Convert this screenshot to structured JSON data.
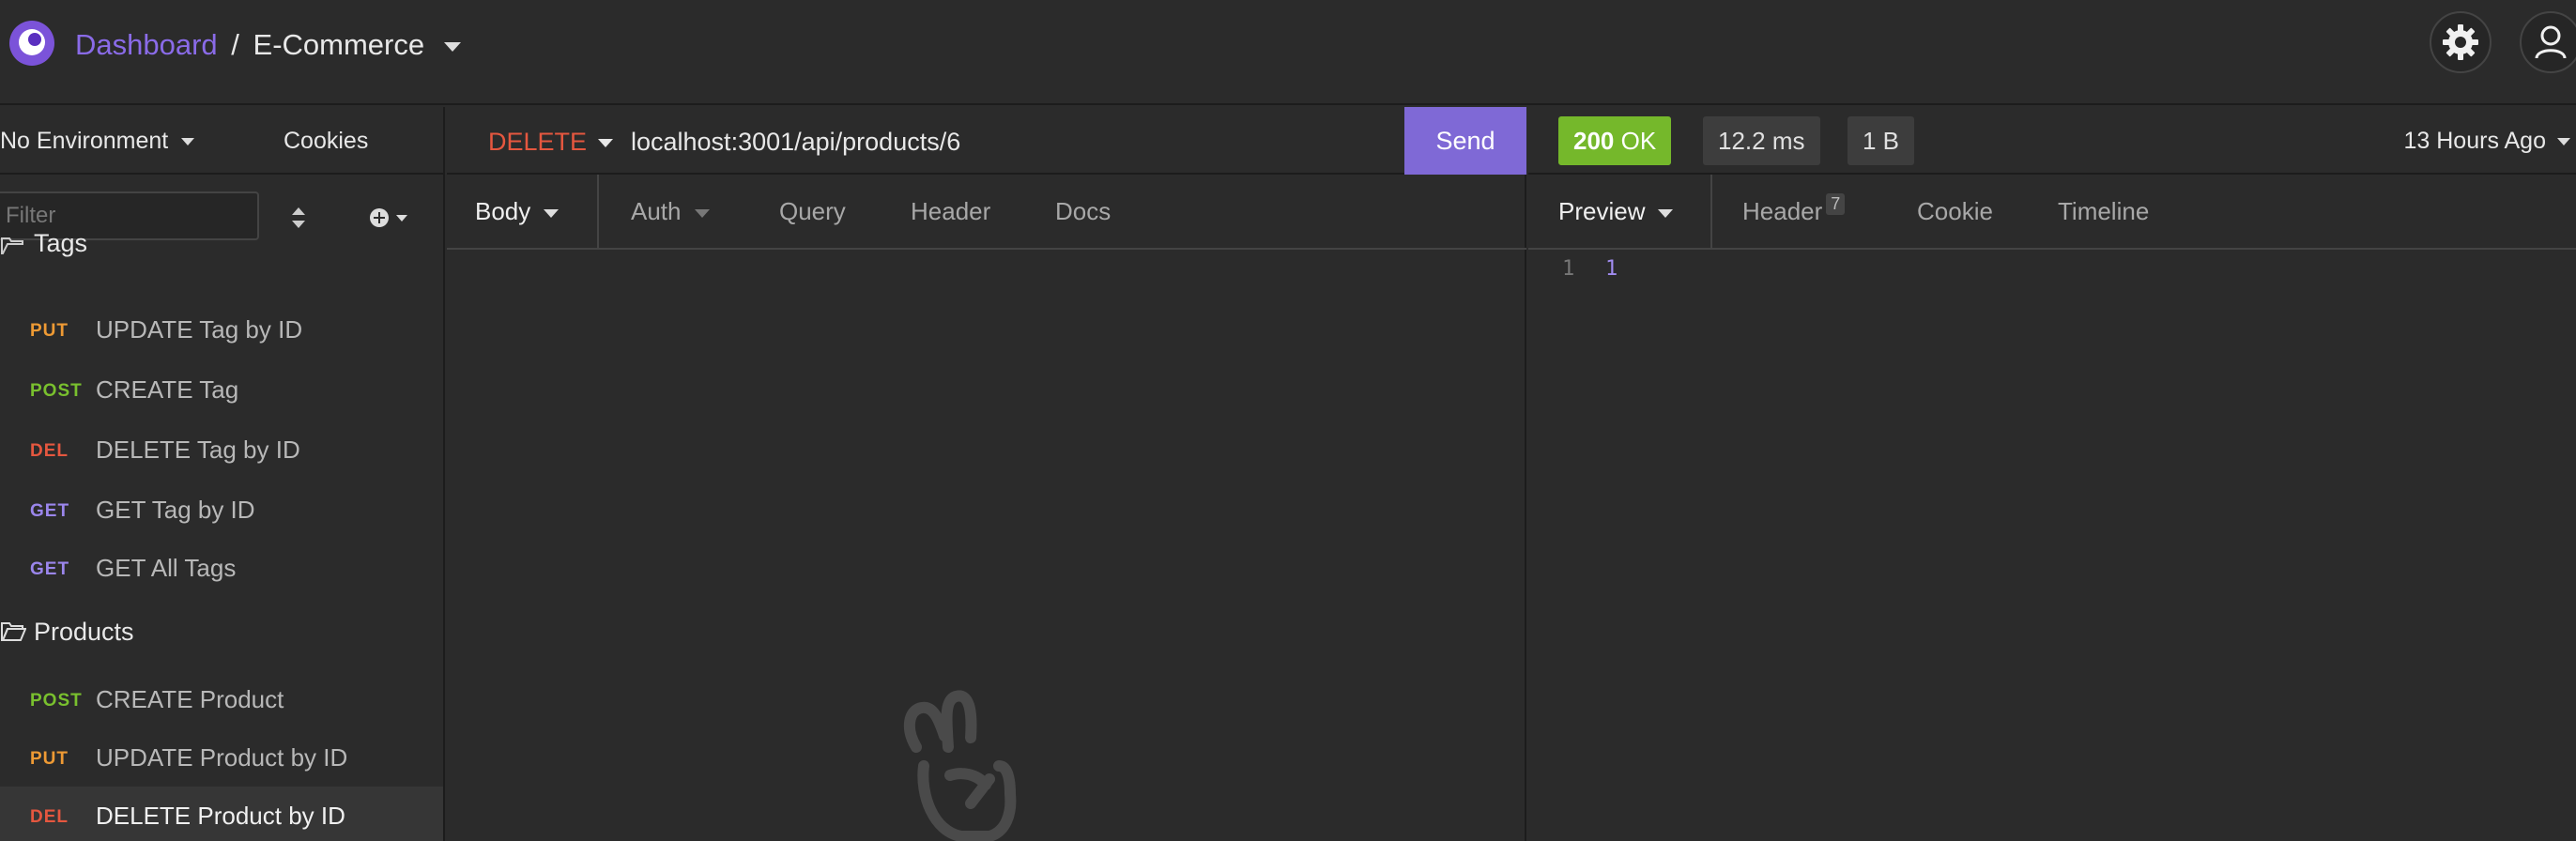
{
  "header": {
    "dashboard_label": "Dashboard",
    "separator": "/",
    "project_name": "E-Commerce"
  },
  "sidebar": {
    "environment": "No Environment",
    "cookies_label": "Cookies",
    "filter_placeholder": "Filter",
    "partial_folder": "Tags",
    "items": [
      {
        "method": "PUT",
        "label": "UPDATE Tag by ID"
      },
      {
        "method": "POST",
        "label": "CREATE Tag"
      },
      {
        "method": "DEL",
        "label": "DELETE Tag by ID"
      },
      {
        "method": "GET",
        "label": "GET Tag by ID"
      },
      {
        "method": "GET",
        "label": "GET All Tags"
      },
      {
        "method": "POST",
        "label": "CREATE Product"
      },
      {
        "method": "PUT",
        "label": "UPDATE Product by ID"
      },
      {
        "method": "DEL",
        "label": "DELETE Product by ID"
      }
    ],
    "folder_products": "Products"
  },
  "request": {
    "method": "DELETE",
    "url": "localhost:3001/api/products/6",
    "send_label": "Send",
    "tabs": [
      "Body",
      "Auth",
      "Query",
      "Header",
      "Docs"
    ]
  },
  "response": {
    "status_code": "200",
    "status_text": "OK",
    "time": "12.2 ms",
    "size": "1 B",
    "time_ago": "13 Hours Ago",
    "tabs": [
      "Preview",
      "Header",
      "Cookie",
      "Timeline"
    ],
    "header_count": "7",
    "line_number": "1",
    "body_value": "1"
  },
  "colors": {
    "accent": "#7f69d6",
    "put": "#ee9a34",
    "post": "#79c02e",
    "delete": "#e5573f",
    "get": "#9b86ec",
    "status_ok": "#75b82b"
  }
}
